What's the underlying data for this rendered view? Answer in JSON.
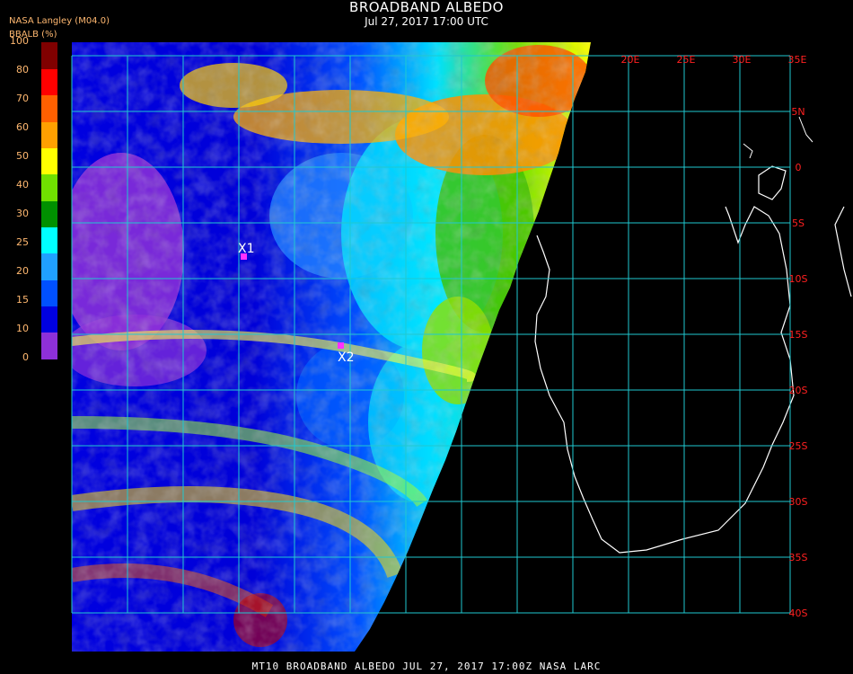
{
  "header": {
    "title": "BROADBAND ALBEDO",
    "subtitle": "Jul 27, 2017 17:00 UTC",
    "agency": "NASA Langley (M04.0)",
    "colorbar_label": "BBALB (%)"
  },
  "colorbar": {
    "ticks": [
      "0",
      "10",
      "15",
      "20",
      "25",
      "30",
      "40",
      "50",
      "60",
      "70",
      "80",
      "100"
    ],
    "colors": [
      "#8e30d8",
      "#0000e0",
      "#0050ff",
      "#20a0ff",
      "#00ffff",
      "#009000",
      "#70e000",
      "#ffff00",
      "#ffa000",
      "#ff6000",
      "#ff0000",
      "#800000"
    ]
  },
  "grid": {
    "color": "#20c8d0",
    "label_color": "#ff2020",
    "lon_labels": [
      "20E",
      "25E",
      "30E",
      "35E"
    ],
    "lat_labels": [
      "5N",
      "0",
      "5S",
      "10S",
      "15S",
      "20S",
      "25S",
      "30S",
      "35S",
      "40S"
    ]
  },
  "markers": [
    {
      "label": "X1"
    },
    {
      "label": "X2"
    }
  ],
  "footer": "MT10  BROADBAND ALBEDO   JUL 27, 2017 17:00Z   NASA LARC"
}
